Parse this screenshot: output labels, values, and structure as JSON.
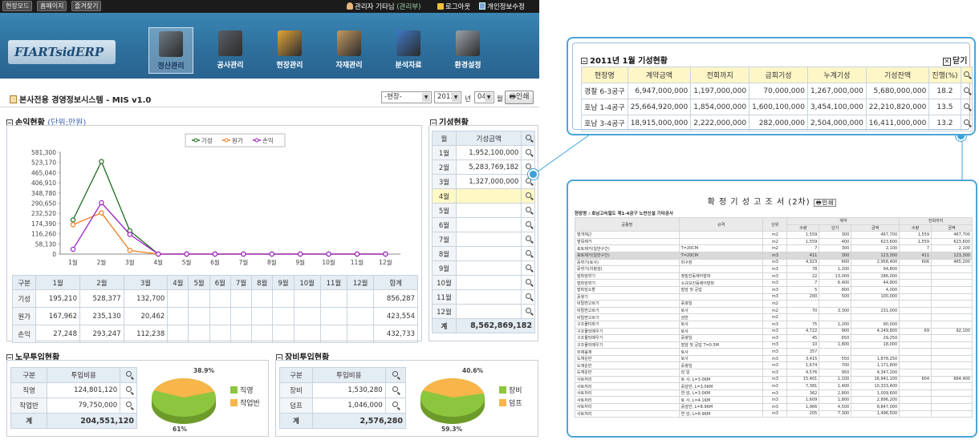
{
  "topbar": {
    "buttons": [
      "현장모드",
      "홈페이지",
      "즐겨찾기"
    ],
    "user": "관리자 기타님",
    "role": "(관리부)",
    "logout": "로그아웃",
    "privacy": "개인정보수정"
  },
  "logo": {
    "text": "FIARTsidERP"
  },
  "nav": [
    {
      "label": "정산관리",
      "color": "#6d7a86",
      "active": true
    },
    {
      "label": "공사관리",
      "color": "#5a5f66",
      "active": false
    },
    {
      "label": "현장관리",
      "color": "#e2a43a",
      "active": false
    },
    {
      "label": "자재관리",
      "color": "#c49a62",
      "active": false
    },
    {
      "label": "분석자료",
      "color": "#3f78c4",
      "active": false
    },
    {
      "label": "환경설정",
      "color": "#9aa3ab",
      "active": false
    }
  ],
  "title": "본사전용 경영정보시스템 - MIS v1.0",
  "filters": {
    "site": "-현장-",
    "year": "2011",
    "year_unit": "년",
    "month": "04",
    "month_unit": "월",
    "print": "인쇄"
  },
  "profit": {
    "heading": "손익현황",
    "unit": "(단위:만원)",
    "table": {
      "headers": [
        "구분",
        "1월",
        "2월",
        "3월",
        "4월",
        "5월",
        "6월",
        "7월",
        "8월",
        "9월",
        "10월",
        "11월",
        "12월",
        "합계"
      ],
      "rows": [
        [
          "기성",
          "195,210",
          "528,377",
          "132,700",
          "",
          "",
          "",
          "",
          "",
          "",
          "",
          "",
          "",
          "856,287"
        ],
        [
          "원가",
          "167,962",
          "235,130",
          "20,462",
          "",
          "",
          "",
          "",
          "",
          "",
          "",
          "",
          "",
          "423,554"
        ],
        [
          "손익",
          "27,248",
          "293,247",
          "112,238",
          "",
          "",
          "",
          "",
          "",
          "",
          "",
          "",
          "",
          "432,733"
        ]
      ]
    }
  },
  "chart_data": {
    "type": "line",
    "categories": [
      "1월",
      "2월",
      "3월",
      "4월",
      "5월",
      "6월",
      "7월",
      "8월",
      "9월",
      "10월",
      "11월",
      "12월"
    ],
    "series": [
      {
        "name": "기성",
        "color": "#1f6b1f",
        "values": [
          195210,
          528377,
          132700,
          0,
          0,
          0,
          0,
          0,
          0,
          0,
          0,
          0
        ]
      },
      {
        "name": "원가",
        "color": "#f07a1a",
        "values": [
          167962,
          235130,
          20462,
          0,
          0,
          0,
          0,
          0,
          0,
          0,
          0,
          0
        ]
      },
      {
        "name": "손익",
        "color": "#9a1fc8",
        "values": [
          27248,
          293247,
          112238,
          0,
          0,
          0,
          0,
          0,
          0,
          0,
          0,
          0
        ]
      }
    ],
    "yticks": [
      "581,300",
      "523,170",
      "465,040",
      "406,910",
      "348,780",
      "290,650",
      "232,520",
      "174,390",
      "116,260",
      "58,130",
      "0"
    ],
    "ylim": [
      0,
      581300
    ],
    "legend": "top-center"
  },
  "progress": {
    "heading": "기성현황",
    "headers": [
      "월",
      "기성금액"
    ],
    "rows": [
      [
        "1월",
        "1,952,100,000"
      ],
      [
        "2월",
        "5,283,769,182"
      ],
      [
        "3월",
        "1,327,000,000"
      ],
      [
        "4월",
        ""
      ],
      [
        "5월",
        ""
      ],
      [
        "6월",
        ""
      ],
      [
        "7월",
        ""
      ],
      [
        "8월",
        ""
      ],
      [
        "9월",
        ""
      ],
      [
        "10월",
        ""
      ],
      [
        "11월",
        ""
      ],
      [
        "12월",
        ""
      ]
    ],
    "total_label": "계",
    "total": "8,562,869,182"
  },
  "labor": {
    "heading": "노무투입현황",
    "headers": [
      "구분",
      "투입비용"
    ],
    "rows": [
      [
        "직영",
        "124,801,120"
      ],
      [
        "작업반",
        "79,750,000"
      ]
    ],
    "total_label": "계",
    "total": "204,551,120",
    "pie": {
      "labels": [
        "38.9%",
        "61%"
      ],
      "legend": [
        {
          "name": "직영",
          "color": "#8cc63e"
        },
        {
          "name": "작업반",
          "color": "#f7b54a"
        }
      ]
    }
  },
  "equipment": {
    "heading": "장비투입현황",
    "headers": [
      "구분",
      "투입비용"
    ],
    "rows": [
      [
        "장비",
        "1,530,280"
      ],
      [
        "덤프",
        "1,046,000"
      ]
    ],
    "total_label": "계",
    "total": "2,576,280",
    "pie": {
      "labels": [
        "40.6%",
        "59.3%"
      ],
      "legend": [
        {
          "name": "장비",
          "color": "#8cc63e"
        },
        {
          "name": "덤프",
          "color": "#f7b54a"
        }
      ]
    }
  },
  "popup1": {
    "title": "2011년 1월 기성현황",
    "close": "닫기",
    "headers": [
      "현장명",
      "계약금액",
      "전회까지",
      "금회기성",
      "누계기성",
      "기성잔액",
      "진행(%)"
    ],
    "rows": [
      [
        "경찰 6-3공구",
        "6,947,000,000",
        "1,197,000,000",
        "70,000,000",
        "1,267,000,000",
        "5,680,000,000",
        "18.2"
      ],
      [
        "호남 1-4공구",
        "25,664,920,000",
        "1,854,000,000",
        "1,600,100,000",
        "3,454,100,000",
        "22,210,820,000",
        "13.5"
      ],
      [
        "호남 3-4공구",
        "18,915,000,000",
        "2,222,000,000",
        "282,000,000",
        "2,504,000,000",
        "16,411,000,000",
        "13.2"
      ]
    ]
  },
  "popup2": {
    "title": "확 정 기 성 고 조 서 (2차)",
    "print": "인쇄",
    "site_line": "현장명 : 호남고속철도 제1-4공구 노반신설 기타공사",
    "headers_top": [
      "공종명",
      "규격",
      "단위",
      "계약",
      "",
      "",
      "전회까지",
      ""
    ],
    "headers_sub": [
      "수량",
      "단가",
      "금액",
      "수량",
      "금액"
    ],
    "rows": [
      [
        "벌개제근",
        "",
        "m2",
        "1,559",
        "300",
        "467,700",
        "1,559",
        "467,700"
      ],
      [
        "벌목제거",
        "",
        "m2",
        "1,559",
        "400",
        "623,600",
        "1,559",
        "623,600"
      ],
      [
        "표토제거(일반구간)",
        "T=20CM",
        "m2",
        "7",
        "300",
        "2,100",
        "7",
        "2,100"
      ],
      [
        "표토제거(일반구간)",
        "T=20CM",
        "m3",
        "411",
        "300",
        "123,300",
        "411",
        "123,300"
      ],
      [
        "흙깎기(토사)",
        "마구장",
        "m3",
        "4,923",
        "600",
        "2,958,400",
        "606",
        "465,200"
      ],
      [
        "흙깎기(리핑암)",
        "",
        "m3",
        "78",
        "1,200",
        "94,800",
        "",
        ""
      ],
      [
        "발파암깎기",
        "정밀진동제어발파",
        "m3",
        "22",
        "13,000",
        "286,000",
        "",
        ""
      ],
      [
        "발파암깎기",
        "소규모진동제어발파",
        "m3",
        "7",
        "6,400",
        "44,800",
        "",
        ""
      ],
      [
        "발파암소할",
        "발암 및 공답",
        "m3",
        "5",
        "800",
        "4,000",
        "",
        ""
      ],
      [
        "흙쌓기",
        "",
        "m3",
        "200",
        "500",
        "100,000",
        "",
        ""
      ],
      [
        "비탈면고르기",
        "흙쌓임",
        "m2",
        "",
        "",
        "",
        "",
        ""
      ],
      [
        "비탈면고르기",
        "토사",
        "m2",
        "70",
        "3,300",
        "231,000",
        "",
        ""
      ],
      [
        "비탈면고르기",
        "암반",
        "m2",
        "",
        "",
        "",
        "",
        ""
      ],
      [
        "구조물터파기",
        "토사",
        "m3",
        "75",
        "1,200",
        "90,000",
        "",
        ""
      ],
      [
        "구조물되메우기",
        "토사",
        "m3",
        "4,722",
        "900",
        "4,249,800",
        "69",
        "92,100"
      ],
      [
        "구조물되메우기",
        "흙쌓임",
        "m3",
        "45",
        "650",
        "29,250",
        "",
        ""
      ],
      [
        "구조물되메우기",
        "발암 및 공답 T=0.5M",
        "m3",
        "10",
        "1,800",
        "18,000",
        "",
        ""
      ],
      [
        "뒤채움재",
        "토사",
        "m3",
        "357",
        "",
        "",
        "",
        ""
      ],
      [
        "도재운반",
        "토사",
        "m3",
        "3,415",
        "550",
        "1,878,250",
        "",
        ""
      ],
      [
        "도재운반",
        "흙쌓임",
        "m3",
        "1,674",
        "700",
        "1,171,800",
        "",
        ""
      ],
      [
        "도재운반",
        "암 일",
        "m3",
        "4,576",
        "950",
        "4,347,200",
        "",
        ""
      ],
      [
        "사토처리",
        "토 사, L=3.0KM",
        "m3",
        "15,401",
        "1,100",
        "16,941,100",
        "604",
        "664,400"
      ],
      [
        "사토처리",
        "흙암반, L=3.0KM",
        "m3",
        "7,381",
        "1,400",
        "10,333,400",
        "",
        ""
      ],
      [
        "사토처리",
        "연 암, L=3.0KM",
        "m3",
        "362",
        "2,800",
        "1,009,600",
        "",
        ""
      ],
      [
        "사토처리",
        "토 사, L=4.1KM",
        "m3",
        "1,609",
        "1,800",
        "2,896,200",
        "",
        ""
      ],
      [
        "사토처리",
        "흙암반, L=8.9KM",
        "m3",
        "1,966",
        "4,500",
        "8,847,000",
        "",
        ""
      ],
      [
        "사토처리",
        "연 암, L=8.9KM",
        "m3",
        "205",
        "7,300",
        "1,496,500",
        "",
        ""
      ]
    ]
  }
}
